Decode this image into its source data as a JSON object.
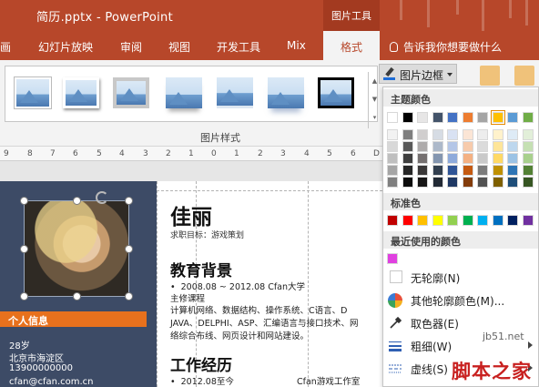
{
  "window": {
    "title": "简历.pptx - PowerPoint",
    "context_tab": "图片工具"
  },
  "tabs": [
    "画",
    "幻灯片放映",
    "审阅",
    "视图",
    "开发工具",
    "Mix",
    "格式"
  ],
  "tellme": "告诉我你想要做什么",
  "ribbon": {
    "group_label": "图片样式",
    "border_button": "图片边框"
  },
  "ruler": [
    "9",
    "8",
    "7",
    "6",
    "5",
    "4",
    "3",
    "2",
    "1",
    "0",
    "1",
    "2",
    "3",
    "4",
    "5",
    "6",
    "D"
  ],
  "slide": {
    "left_panel": {
      "section_label": "个人信息",
      "age": "28岁",
      "location": "北京市海淀区",
      "phone": "13900000000",
      "email": "cfan@cfan.com.cn"
    },
    "name": "佳丽",
    "objective": "求职目标：游戏策划",
    "education_heading": "教育背景",
    "education_lines": [
      "2008.08 ~ 2012.08  Cfan大学",
      "主修课程",
      "计算机网络、数据结构、操作系统、C语言、D",
      "JAVA、DELPHI、ASP、汇编语言与接口技术、网",
      "络综合布线、网页设计和网站建设。"
    ],
    "work_heading": "工作经历",
    "work_line_date": "2012.08至今",
    "work_line_company": "Cfan游戏工作室"
  },
  "dropdown": {
    "theme_colors_label": "主题颜色",
    "standard_colors_label": "标准色",
    "recent_colors_label": "最近使用的颜色",
    "no_outline": "无轮廓(N)",
    "more_colors": "其他轮廓颜色(M)...",
    "eyedropper": "取色器(E)",
    "weight": "粗细(W)",
    "dashes": "虚线(S)",
    "theme_top_row": [
      "#ffffff",
      "#000000",
      "#e7e6e6",
      "#44546a",
      "#4472c4",
      "#ed7d31",
      "#a5a5a5",
      "#ffc000",
      "#5b9bd5",
      "#70ad47"
    ],
    "theme_shade_rows": [
      [
        "#f2f2f2",
        "#7f7f7f",
        "#d0cece",
        "#d6dce4",
        "#d9e2f3",
        "#fbe5d5",
        "#ededed",
        "#fff2cc",
        "#deebf6",
        "#e2efd9"
      ],
      [
        "#d8d8d8",
        "#595959",
        "#aeabab",
        "#adb9ca",
        "#b4c6e7",
        "#f7cbac",
        "#dbdbdb",
        "#fee599",
        "#bdd7ee",
        "#c5e0b3"
      ],
      [
        "#bfbfbf",
        "#3f3f3f",
        "#757070",
        "#8496b0",
        "#8eaadb",
        "#f4b183",
        "#c9c9c9",
        "#ffd965",
        "#9cc3e5",
        "#a8d08d"
      ],
      [
        "#a5a5a5",
        "#262626",
        "#3a3838",
        "#323f4f",
        "#2f5496",
        "#c55a11",
        "#7b7b7b",
        "#bf9000",
        "#2e75b5",
        "#538135"
      ],
      [
        "#7f7f7f",
        "#0c0c0c",
        "#171616",
        "#222a35",
        "#1f3864",
        "#833c0b",
        "#525252",
        "#7f6000",
        "#1e4e79",
        "#375623"
      ]
    ],
    "selected_theme_color": "#ffc000",
    "standard_colors": [
      "#c00000",
      "#ff0000",
      "#ffc000",
      "#ffff00",
      "#92d050",
      "#00b050",
      "#00b0f0",
      "#0070c0",
      "#002060",
      "#7030a0"
    ],
    "recent_colors": [
      "#e040e0"
    ]
  },
  "watermark": {
    "url": "jb51.net",
    "logo": "脚本之家"
  }
}
